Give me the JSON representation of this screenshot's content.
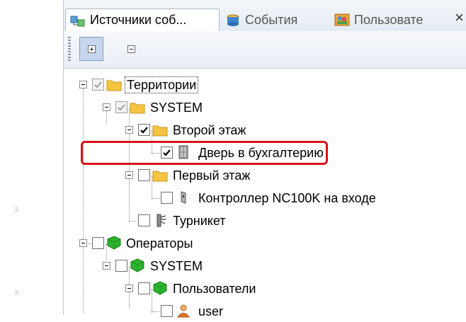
{
  "gutter": [
    "з",
    "з"
  ],
  "tabs": [
    {
      "label": "Источники соб...",
      "icon": "event-sources-icon"
    },
    {
      "label": "События",
      "icon": "events-icon"
    },
    {
      "label": "Пользовате",
      "icon": "users-icon"
    }
  ],
  "tab_close": "×",
  "toolbar": {
    "expand_all": "expand-all-icon",
    "collapse_all": "collapse-all-icon"
  },
  "tree": {
    "territories": "Территории",
    "system1": "SYSTEM",
    "floor2": "Второй этаж",
    "door": "Дверь в бухгалтерию",
    "floor1": "Первый этаж",
    "controller": "Контроллер NC100K на входе",
    "turnstile": "Турникет",
    "operators": "Операторы",
    "system2": "SYSTEM",
    "users": "Пользователи",
    "user": "user"
  },
  "colors": {
    "highlight": "#d6141b",
    "folder": "#f5c542",
    "green": "#2bb52b"
  }
}
